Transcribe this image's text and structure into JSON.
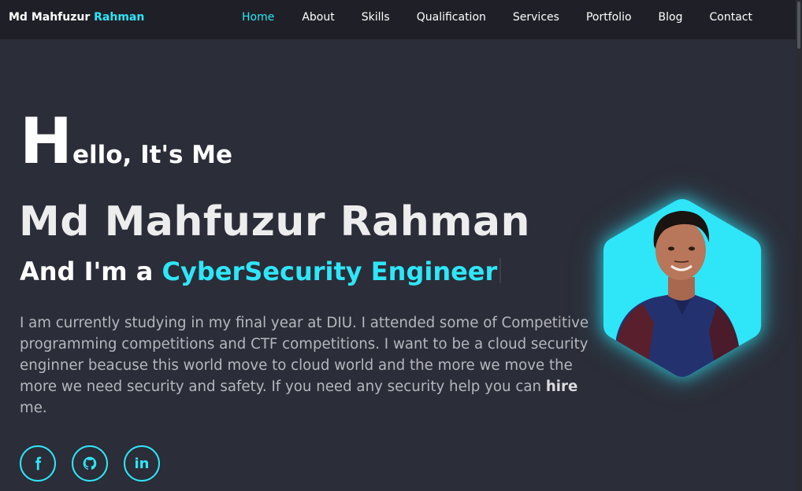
{
  "header": {
    "logo_first": "Md Mahfuzur",
    "logo_accent": "Rahman",
    "nav": [
      {
        "label": "Home",
        "active": true
      },
      {
        "label": "About",
        "active": false
      },
      {
        "label": "Skills",
        "active": false
      },
      {
        "label": "Qualification",
        "active": false
      },
      {
        "label": "Services",
        "active": false
      },
      {
        "label": "Portfolio",
        "active": false
      },
      {
        "label": "Blog",
        "active": false
      },
      {
        "label": "Contact",
        "active": false
      }
    ]
  },
  "hero": {
    "hello_initial": "H",
    "hello_rest": "ello, It's Me",
    "name": "Md Mahfuzur Rahman",
    "role_prefix": "And I'm a",
    "role_typed": "CyberSecurity Engineer",
    "about_before": "I am currently studying in my final year at DIU. I attended some of Competitive programming competitions and CTF competitions. I want to be a cloud security enginner beacuse this world move to cloud world and the more we move the more we need security and safety. If you need any security help you can",
    "about_bold": "hire",
    "about_after": "me."
  },
  "socials": [
    {
      "icon": "facebook-icon"
    },
    {
      "icon": "github-icon"
    },
    {
      "icon": "linkedin-icon",
      "text": "in"
    }
  ],
  "colors": {
    "accent": "#2ee6f8",
    "background": "#2b2d38",
    "header_bg": "#1f2027"
  }
}
